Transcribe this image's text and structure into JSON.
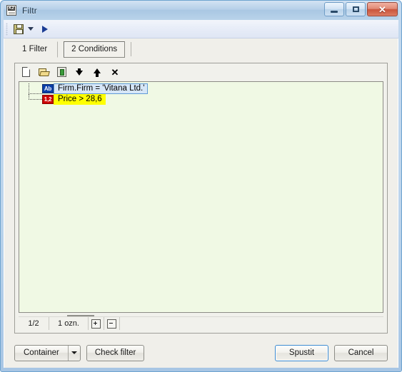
{
  "window": {
    "title": "Filtr",
    "icon": "k2-document-icon",
    "controls": {
      "minimize": "minimize-icon",
      "maximize": "maximize-icon",
      "close": "✕"
    }
  },
  "toolbar": {
    "items": [
      {
        "name": "save-button",
        "icon": "floppy-disk-icon"
      },
      {
        "name": "save-dropdown-button",
        "icon": "chevron-down-icon"
      },
      {
        "name": "run-button",
        "icon": "play-icon"
      }
    ]
  },
  "tabs": [
    {
      "label": "1 Filter",
      "active": false
    },
    {
      "label": "2 Conditions",
      "active": true
    }
  ],
  "panel": {
    "toolbar": [
      {
        "name": "new-condition-button",
        "icon": "new-page-icon"
      },
      {
        "name": "open-condition-button",
        "icon": "open-folder-icon"
      },
      {
        "name": "container-button",
        "icon": "box-icon"
      },
      {
        "name": "move-down-button",
        "icon": "arrow-down-icon"
      },
      {
        "name": "move-up-button",
        "icon": "arrow-up-icon"
      },
      {
        "name": "delete-condition-button",
        "icon": "x-icon"
      }
    ],
    "conditions": [
      {
        "badge": "Ab",
        "badge_type": "text",
        "text": "Firm.Firm = 'Vitana Ltd.'",
        "state": "selected"
      },
      {
        "badge": "1,2",
        "badge_type": "number",
        "text": "Price > 28,6",
        "state": "highlighted"
      }
    ],
    "status": {
      "position": "1/2",
      "selection": "1 ozn.",
      "expand_all": "expand-all-button",
      "collapse_all": "collapse-all-button"
    }
  },
  "buttons": {
    "container": "Container",
    "check_filter": "Check filter",
    "run": "Spustit",
    "cancel": "Cancel"
  },
  "colors": {
    "accent": "#3c8ad0",
    "panel_background": "#f0f9e4",
    "selection": "#d6e6f7",
    "highlight": "#ffff00",
    "badge_text": "#0a3fa8",
    "badge_number": "#cc0000"
  }
}
